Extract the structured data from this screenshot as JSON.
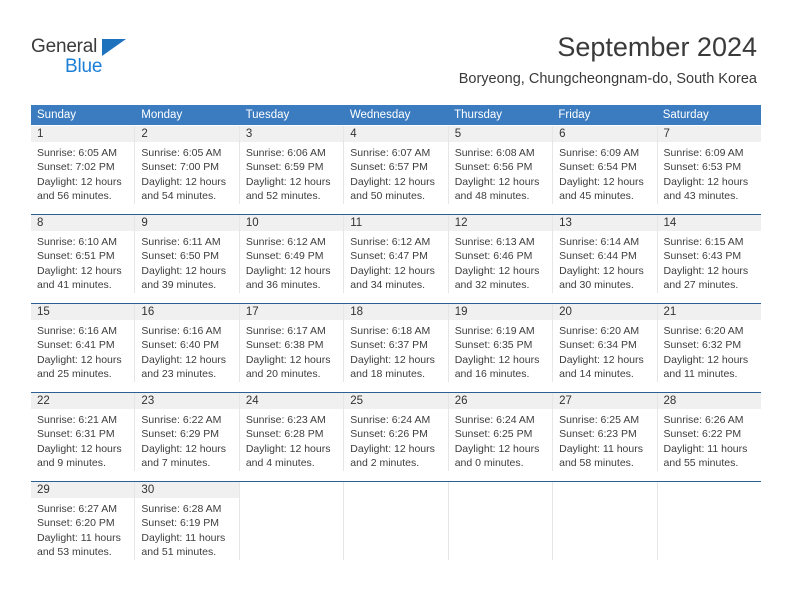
{
  "brand": {
    "name_part1": "General",
    "name_part2": "Blue",
    "triangle_color": "#1c72bd",
    "blue_color": "#1c7fd6"
  },
  "header": {
    "month_title": "September 2024",
    "location": "Boryeong, Chungcheongnam-do, South Korea",
    "header_bg": "#3b7cc0",
    "row_border": "#2d5f92",
    "daynum_bg": "#f0f0f0"
  },
  "weekday_headers": [
    "Sunday",
    "Monday",
    "Tuesday",
    "Wednesday",
    "Thursday",
    "Friday",
    "Saturday"
  ],
  "weeks": [
    [
      {
        "day": "1",
        "sunrise": "Sunrise: 6:05 AM",
        "sunset": "Sunset: 7:02 PM",
        "daylight1": "Daylight: 12 hours",
        "daylight2": "and 56 minutes."
      },
      {
        "day": "2",
        "sunrise": "Sunrise: 6:05 AM",
        "sunset": "Sunset: 7:00 PM",
        "daylight1": "Daylight: 12 hours",
        "daylight2": "and 54 minutes."
      },
      {
        "day": "3",
        "sunrise": "Sunrise: 6:06 AM",
        "sunset": "Sunset: 6:59 PM",
        "daylight1": "Daylight: 12 hours",
        "daylight2": "and 52 minutes."
      },
      {
        "day": "4",
        "sunrise": "Sunrise: 6:07 AM",
        "sunset": "Sunset: 6:57 PM",
        "daylight1": "Daylight: 12 hours",
        "daylight2": "and 50 minutes."
      },
      {
        "day": "5",
        "sunrise": "Sunrise: 6:08 AM",
        "sunset": "Sunset: 6:56 PM",
        "daylight1": "Daylight: 12 hours",
        "daylight2": "and 48 minutes."
      },
      {
        "day": "6",
        "sunrise": "Sunrise: 6:09 AM",
        "sunset": "Sunset: 6:54 PM",
        "daylight1": "Daylight: 12 hours",
        "daylight2": "and 45 minutes."
      },
      {
        "day": "7",
        "sunrise": "Sunrise: 6:09 AM",
        "sunset": "Sunset: 6:53 PM",
        "daylight1": "Daylight: 12 hours",
        "daylight2": "and 43 minutes."
      }
    ],
    [
      {
        "day": "8",
        "sunrise": "Sunrise: 6:10 AM",
        "sunset": "Sunset: 6:51 PM",
        "daylight1": "Daylight: 12 hours",
        "daylight2": "and 41 minutes."
      },
      {
        "day": "9",
        "sunrise": "Sunrise: 6:11 AM",
        "sunset": "Sunset: 6:50 PM",
        "daylight1": "Daylight: 12 hours",
        "daylight2": "and 39 minutes."
      },
      {
        "day": "10",
        "sunrise": "Sunrise: 6:12 AM",
        "sunset": "Sunset: 6:49 PM",
        "daylight1": "Daylight: 12 hours",
        "daylight2": "and 36 minutes."
      },
      {
        "day": "11",
        "sunrise": "Sunrise: 6:12 AM",
        "sunset": "Sunset: 6:47 PM",
        "daylight1": "Daylight: 12 hours",
        "daylight2": "and 34 minutes."
      },
      {
        "day": "12",
        "sunrise": "Sunrise: 6:13 AM",
        "sunset": "Sunset: 6:46 PM",
        "daylight1": "Daylight: 12 hours",
        "daylight2": "and 32 minutes."
      },
      {
        "day": "13",
        "sunrise": "Sunrise: 6:14 AM",
        "sunset": "Sunset: 6:44 PM",
        "daylight1": "Daylight: 12 hours",
        "daylight2": "and 30 minutes."
      },
      {
        "day": "14",
        "sunrise": "Sunrise: 6:15 AM",
        "sunset": "Sunset: 6:43 PM",
        "daylight1": "Daylight: 12 hours",
        "daylight2": "and 27 minutes."
      }
    ],
    [
      {
        "day": "15",
        "sunrise": "Sunrise: 6:16 AM",
        "sunset": "Sunset: 6:41 PM",
        "daylight1": "Daylight: 12 hours",
        "daylight2": "and 25 minutes."
      },
      {
        "day": "16",
        "sunrise": "Sunrise: 6:16 AM",
        "sunset": "Sunset: 6:40 PM",
        "daylight1": "Daylight: 12 hours",
        "daylight2": "and 23 minutes."
      },
      {
        "day": "17",
        "sunrise": "Sunrise: 6:17 AM",
        "sunset": "Sunset: 6:38 PM",
        "daylight1": "Daylight: 12 hours",
        "daylight2": "and 20 minutes."
      },
      {
        "day": "18",
        "sunrise": "Sunrise: 6:18 AM",
        "sunset": "Sunset: 6:37 PM",
        "daylight1": "Daylight: 12 hours",
        "daylight2": "and 18 minutes."
      },
      {
        "day": "19",
        "sunrise": "Sunrise: 6:19 AM",
        "sunset": "Sunset: 6:35 PM",
        "daylight1": "Daylight: 12 hours",
        "daylight2": "and 16 minutes."
      },
      {
        "day": "20",
        "sunrise": "Sunrise: 6:20 AM",
        "sunset": "Sunset: 6:34 PM",
        "daylight1": "Daylight: 12 hours",
        "daylight2": "and 14 minutes."
      },
      {
        "day": "21",
        "sunrise": "Sunrise: 6:20 AM",
        "sunset": "Sunset: 6:32 PM",
        "daylight1": "Daylight: 12 hours",
        "daylight2": "and 11 minutes."
      }
    ],
    [
      {
        "day": "22",
        "sunrise": "Sunrise: 6:21 AM",
        "sunset": "Sunset: 6:31 PM",
        "daylight1": "Daylight: 12 hours",
        "daylight2": "and 9 minutes."
      },
      {
        "day": "23",
        "sunrise": "Sunrise: 6:22 AM",
        "sunset": "Sunset: 6:29 PM",
        "daylight1": "Daylight: 12 hours",
        "daylight2": "and 7 minutes."
      },
      {
        "day": "24",
        "sunrise": "Sunrise: 6:23 AM",
        "sunset": "Sunset: 6:28 PM",
        "daylight1": "Daylight: 12 hours",
        "daylight2": "and 4 minutes."
      },
      {
        "day": "25",
        "sunrise": "Sunrise: 6:24 AM",
        "sunset": "Sunset: 6:26 PM",
        "daylight1": "Daylight: 12 hours",
        "daylight2": "and 2 minutes."
      },
      {
        "day": "26",
        "sunrise": "Sunrise: 6:24 AM",
        "sunset": "Sunset: 6:25 PM",
        "daylight1": "Daylight: 12 hours",
        "daylight2": "and 0 minutes."
      },
      {
        "day": "27",
        "sunrise": "Sunrise: 6:25 AM",
        "sunset": "Sunset: 6:23 PM",
        "daylight1": "Daylight: 11 hours",
        "daylight2": "and 58 minutes."
      },
      {
        "day": "28",
        "sunrise": "Sunrise: 6:26 AM",
        "sunset": "Sunset: 6:22 PM",
        "daylight1": "Daylight: 11 hours",
        "daylight2": "and 55 minutes."
      }
    ],
    [
      {
        "day": "29",
        "sunrise": "Sunrise: 6:27 AM",
        "sunset": "Sunset: 6:20 PM",
        "daylight1": "Daylight: 11 hours",
        "daylight2": "and 53 minutes."
      },
      {
        "day": "30",
        "sunrise": "Sunrise: 6:28 AM",
        "sunset": "Sunset: 6:19 PM",
        "daylight1": "Daylight: 11 hours",
        "daylight2": "and 51 minutes."
      },
      {
        "day": "",
        "sunrise": "",
        "sunset": "",
        "daylight1": "",
        "daylight2": ""
      },
      {
        "day": "",
        "sunrise": "",
        "sunset": "",
        "daylight1": "",
        "daylight2": ""
      },
      {
        "day": "",
        "sunrise": "",
        "sunset": "",
        "daylight1": "",
        "daylight2": ""
      },
      {
        "day": "",
        "sunrise": "",
        "sunset": "",
        "daylight1": "",
        "daylight2": ""
      },
      {
        "day": "",
        "sunrise": "",
        "sunset": "",
        "daylight1": "",
        "daylight2": ""
      }
    ]
  ]
}
